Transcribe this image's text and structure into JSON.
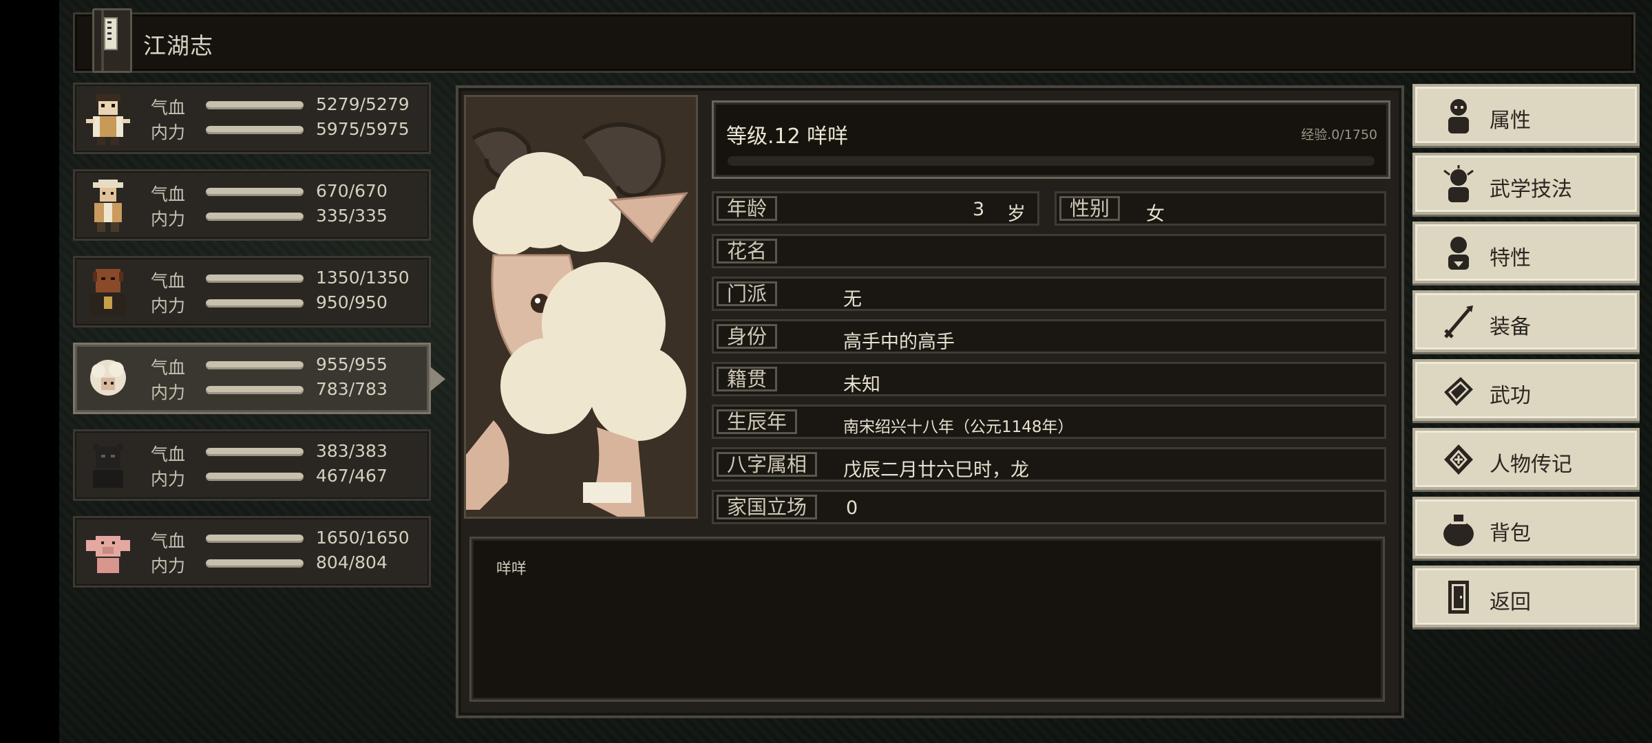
{
  "header": {
    "title": "江湖志"
  },
  "party": [
    {
      "hp_label": "气血",
      "hp_value": "5279/5279",
      "mp_label": "内力",
      "mp_value": "5975/5975",
      "avatar": "warrior-portrait",
      "selected": false
    },
    {
      "hp_label": "气血",
      "hp_value": "670/670",
      "mp_label": "内力",
      "mp_value": "335/335",
      "avatar": "hat-man-portrait",
      "selected": false
    },
    {
      "hp_label": "气血",
      "hp_value": "1350/1350",
      "mp_label": "内力",
      "mp_value": "950/950",
      "avatar": "dark-figure-portrait",
      "selected": false
    },
    {
      "hp_label": "气血",
      "hp_value": "955/955",
      "mp_label": "内力",
      "mp_value": "783/783",
      "avatar": "sheep-portrait",
      "selected": true
    },
    {
      "hp_label": "气血",
      "hp_value": "383/383",
      "mp_label": "内力",
      "mp_value": "467/467",
      "avatar": "black-beast-portrait",
      "selected": false
    },
    {
      "hp_label": "气血",
      "hp_value": "1650/1650",
      "mp_label": "内力",
      "mp_value": "804/804",
      "avatar": "pig-portrait",
      "selected": false
    }
  ],
  "character": {
    "level_name": "等级.12 咩咩",
    "exp": "经验.0/1750",
    "exp_progress": 0,
    "age_label": "年龄",
    "age_value": "3",
    "age_unit": "岁",
    "gender_label": "性别",
    "gender_value": "女",
    "nickname_label": "花名",
    "nickname_value": "",
    "sect_label": "门派",
    "sect_value": "无",
    "identity_label": "身份",
    "identity_value": "高手中的高手",
    "origin_label": "籍贯",
    "origin_value": "未知",
    "birth_label": "生辰年",
    "birth_value": "南宋绍兴十八年（公元1148年）",
    "bazi_label": "八字属相",
    "bazi_value": "戊辰二月廿六巳时，龙",
    "stance_label": "家国立场",
    "stance_value": "0",
    "description": "咩咩"
  },
  "menu": [
    {
      "label": "属性",
      "icon": "person-icon"
    },
    {
      "label": "武学技法",
      "icon": "skill-person-icon"
    },
    {
      "label": "特性",
      "icon": "trait-person-icon"
    },
    {
      "label": "装备",
      "icon": "sword-icon"
    },
    {
      "label": "武功",
      "icon": "manual-book-icon"
    },
    {
      "label": "人物传记",
      "icon": "scroll-icon"
    },
    {
      "label": "背包",
      "icon": "bag-icon"
    },
    {
      "label": "返回",
      "icon": "door-icon"
    }
  ],
  "colors": {
    "button_bg": "#ddd6c0",
    "panel_bg": "#23201c",
    "text": "#e8e1cf"
  }
}
